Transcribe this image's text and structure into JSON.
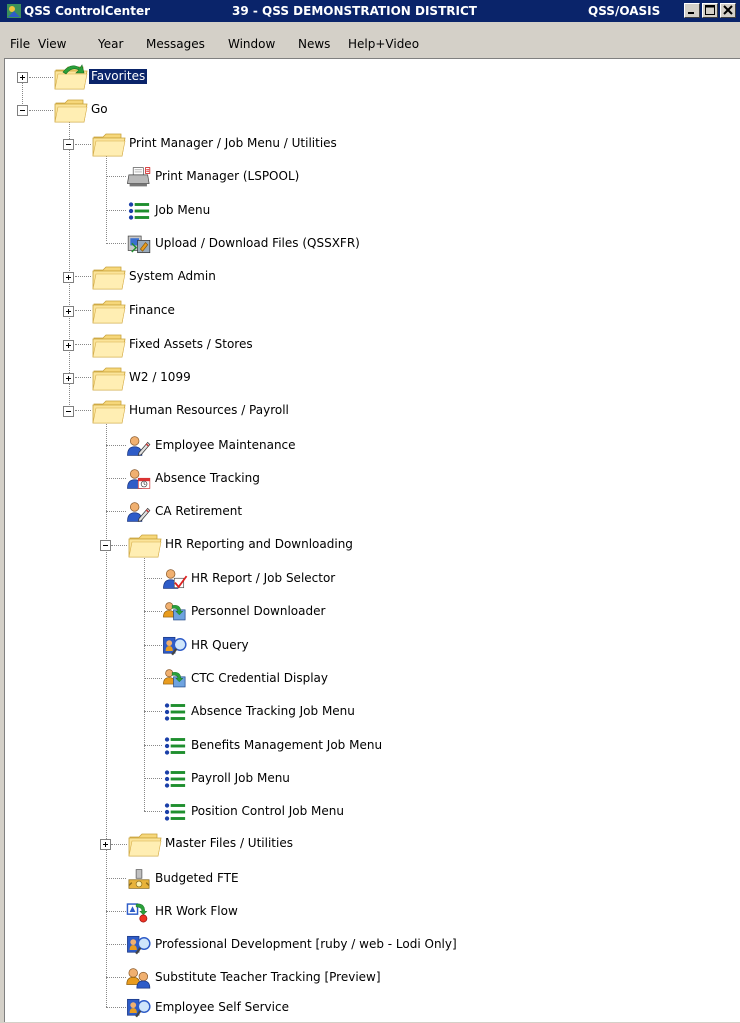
{
  "window": {
    "app_name": "QSS ControlCenter",
    "district": "39 - QSS DEMONSTRATION DISTRICT",
    "system": "QSS/OASIS"
  },
  "menu": [
    "File",
    "View",
    "Year",
    "Messages",
    "Window",
    "News",
    "Help+Video"
  ],
  "tree": {
    "favorites": "Favorites",
    "go": "Go",
    "print_group": "Print Manager / Job Menu / Utilities",
    "print_manager": "Print Manager (LSPOOL)",
    "job_menu": "Job Menu",
    "upload_download": "Upload / Download Files (QSSXFR)",
    "system_admin": "System Admin",
    "finance": "Finance",
    "fixed_assets": "Fixed Assets / Stores",
    "w2_1099": "W2 / 1099",
    "hr_payroll": "Human Resources / Payroll",
    "employee_maintenance": "Employee Maintenance",
    "absence_tracking": "Absence Tracking",
    "ca_retirement": "CA Retirement",
    "hr_reporting": "HR Reporting and Downloading",
    "hr_report_job_selector": "HR Report / Job Selector",
    "personnel_downloader": "Personnel Downloader",
    "hr_query": "HR Query",
    "ctc_credential": "CTC Credential Display",
    "absence_job_menu": "Absence Tracking Job Menu",
    "benefits_job_menu": "Benefits Management Job Menu",
    "payroll_job_menu": "Payroll Job Menu",
    "position_job_menu": "Position Control Job Menu",
    "master_files": "Master Files / Utilities",
    "budgeted_fte": "Budgeted FTE",
    "hr_work_flow": "HR Work Flow",
    "professional_dev": "Professional Development [ruby / web - Lodi Only]",
    "substitute_teacher": "Substitute Teacher Tracking [Preview]",
    "employee_self_service": "Employee Self Service"
  }
}
